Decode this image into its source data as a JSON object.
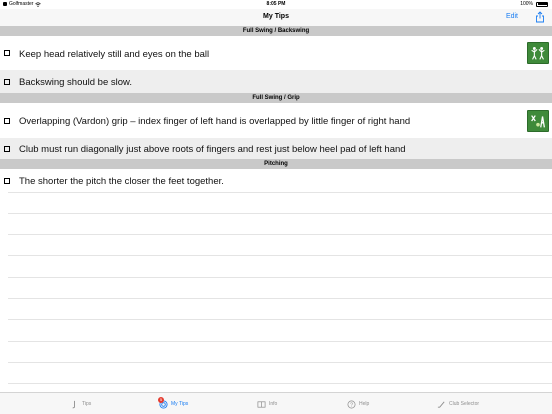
{
  "status_bar": {
    "carrier": "Golfmaster",
    "time": "8:05 PM",
    "battery": "100%"
  },
  "nav": {
    "title": "My Tips",
    "edit_label": "Edit"
  },
  "sections": [
    {
      "header": "Full Swing / Backswing",
      "rows": [
        {
          "text": "Keep head relatively still and eyes on the ball",
          "has_thumbnail": true
        },
        {
          "text": "Backswing should be slow.",
          "has_thumbnail": false
        }
      ]
    },
    {
      "header": "Full Swing / Grip",
      "rows": [
        {
          "text": "Overlapping (Vardon) grip – index finger of left hand is overlapped by little finger of right hand",
          "has_thumbnail": true
        },
        {
          "text": "Club must run diagonally just above roots of fingers and rest just below heel pad of left hand",
          "has_thumbnail": false
        }
      ]
    },
    {
      "header": "Pitching",
      "rows": [
        {
          "text": "The shorter the pitch the closer the feet together.",
          "has_thumbnail": false
        }
      ]
    }
  ],
  "tab_bar": {
    "tabs": [
      {
        "label": "Tips",
        "icon": "golf-club-icon",
        "active": false
      },
      {
        "label": "My Tips",
        "icon": "target-icon",
        "active": true,
        "badge": "5"
      },
      {
        "label": "Info",
        "icon": "book-icon",
        "active": false
      },
      {
        "label": "Help",
        "icon": "help-icon",
        "active": false
      },
      {
        "label": "Club Selector",
        "icon": "club-selector-icon",
        "active": false
      }
    ]
  },
  "colors": {
    "accent": "#1a7df2",
    "section_header_bg": "#c9c9c9",
    "alt_row_bg": "#eeeeee",
    "thumbnail_green": "#3f8a3a",
    "badge": "#e53b2f"
  }
}
